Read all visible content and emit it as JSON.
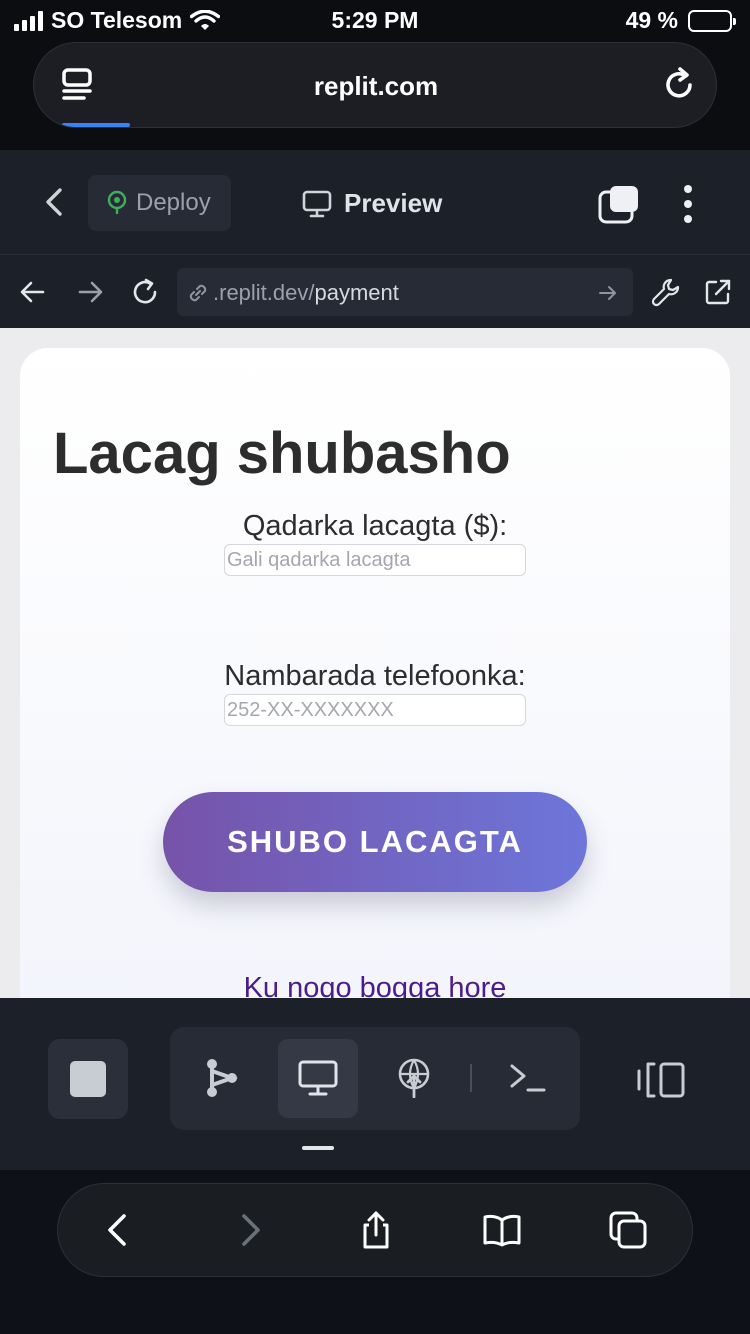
{
  "status_bar": {
    "carrier": "SO Telesom",
    "time": "5:29 PM",
    "battery_percent": "49 %",
    "battery_level": 0.49
  },
  "safari": {
    "domain": "replit.com",
    "load_progress": 0.1
  },
  "replit_header": {
    "deploy_label": "Deploy",
    "preview_label": "Preview"
  },
  "webview_bar": {
    "address_prefix": ".replit.dev/",
    "address_path": "payment"
  },
  "page": {
    "title": "Lacag shubasho",
    "amount_label": "Qadarka lacagta ($):",
    "amount_placeholder": "Gali qadarka lacagta",
    "phone_label": "Nambarada telefoonka:",
    "phone_placeholder": "252-XX-XXXXXXX",
    "submit_label": "SHUBO LACAGTA",
    "home_link": "Ku noqo bogga hore"
  },
  "colors": {
    "accent_blue": "#3b82f6",
    "button_gradient_start": "#7653a9",
    "button_gradient_end": "#6d76da",
    "link_purple": "#4b1d8a",
    "battery_green": "#4cd964",
    "deploy_green": "#3fae5b"
  },
  "icons": {
    "safari_tabs": "tabs-icon",
    "reload": "reload-icon",
    "back": "chevron-left-icon",
    "deploy": "deploy-icon",
    "preview": "monitor-icon",
    "windows": "windows-icon",
    "more": "more-vertical-icon",
    "web_back": "arrow-left-icon",
    "web_forward": "arrow-right-icon",
    "web_refresh": "refresh-icon",
    "link": "link-icon",
    "go": "arrow-right-icon",
    "tools": "wrench-icon",
    "open_external": "external-link-icon",
    "stop": "stop-icon",
    "workflow": "workflow-icon",
    "webview": "monitor-icon",
    "deployments": "deploy-icon",
    "shell": "terminal-icon",
    "layout": "layout-icon",
    "safari_back": "chevron-left-icon",
    "safari_forward": "chevron-right-icon",
    "share": "share-icon",
    "bookmarks": "book-icon",
    "safari_tabs_bottom": "tabs-icon"
  }
}
